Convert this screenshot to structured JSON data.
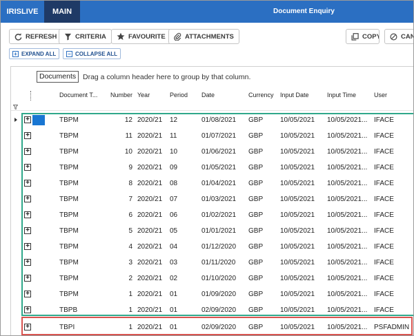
{
  "topbar": {
    "tabs": [
      {
        "label": "IRISLIVE"
      },
      {
        "label": "MAIN"
      }
    ],
    "title": "Document Enquiry"
  },
  "toolbar": {
    "refresh_label": "REFRESH",
    "criteria_label": "CRITERIA",
    "favourite_label": "FAVOURITE",
    "attachments_label": "ATTACHMENTS",
    "copy_label": "COPY",
    "cancel_label": "CANC"
  },
  "subtoolbar": {
    "expand_all_label": "EXPAND ALL",
    "collapse_all_label": "COLLAPSE ALL"
  },
  "grid": {
    "group_chip": "Documents",
    "group_hint": "Drag a column header here to group by that column.",
    "columns": [
      "Document T...",
      "Number",
      "Year",
      "Period",
      "Date",
      "Currency",
      "Input Date",
      "Input Time",
      "User"
    ],
    "rows": [
      {
        "doc_type": "TBPM",
        "number": "12",
        "year": "2020/21",
        "period": "12",
        "date": "01/08/2021",
        "currency": "GBP",
        "input_date": "10/05/2021",
        "input_time": "10/05/2021...",
        "user": "IFACE"
      },
      {
        "doc_type": "TBPM",
        "number": "11",
        "year": "2020/21",
        "period": "11",
        "date": "01/07/2021",
        "currency": "GBP",
        "input_date": "10/05/2021",
        "input_time": "10/05/2021...",
        "user": "IFACE"
      },
      {
        "doc_type": "TBPM",
        "number": "10",
        "year": "2020/21",
        "period": "10",
        "date": "01/06/2021",
        "currency": "GBP",
        "input_date": "10/05/2021",
        "input_time": "10/05/2021...",
        "user": "IFACE"
      },
      {
        "doc_type": "TBPM",
        "number": "9",
        "year": "2020/21",
        "period": "09",
        "date": "01/05/2021",
        "currency": "GBP",
        "input_date": "10/05/2021",
        "input_time": "10/05/2021...",
        "user": "IFACE"
      },
      {
        "doc_type": "TBPM",
        "number": "8",
        "year": "2020/21",
        "period": "08",
        "date": "01/04/2021",
        "currency": "GBP",
        "input_date": "10/05/2021",
        "input_time": "10/05/2021...",
        "user": "IFACE"
      },
      {
        "doc_type": "TBPM",
        "number": "7",
        "year": "2020/21",
        "period": "07",
        "date": "01/03/2021",
        "currency": "GBP",
        "input_date": "10/05/2021",
        "input_time": "10/05/2021...",
        "user": "IFACE"
      },
      {
        "doc_type": "TBPM",
        "number": "6",
        "year": "2020/21",
        "period": "06",
        "date": "01/02/2021",
        "currency": "GBP",
        "input_date": "10/05/2021",
        "input_time": "10/05/2021...",
        "user": "IFACE"
      },
      {
        "doc_type": "TBPM",
        "number": "5",
        "year": "2020/21",
        "period": "05",
        "date": "01/01/2021",
        "currency": "GBP",
        "input_date": "10/05/2021",
        "input_time": "10/05/2021...",
        "user": "IFACE"
      },
      {
        "doc_type": "TBPM",
        "number": "4",
        "year": "2020/21",
        "period": "04",
        "date": "01/12/2020",
        "currency": "GBP",
        "input_date": "10/05/2021",
        "input_time": "10/05/2021...",
        "user": "IFACE"
      },
      {
        "doc_type": "TBPM",
        "number": "3",
        "year": "2020/21",
        "period": "03",
        "date": "01/11/2020",
        "currency": "GBP",
        "input_date": "10/05/2021",
        "input_time": "10/05/2021...",
        "user": "IFACE"
      },
      {
        "doc_type": "TBPM",
        "number": "2",
        "year": "2020/21",
        "period": "02",
        "date": "01/10/2020",
        "currency": "GBP",
        "input_date": "10/05/2021",
        "input_time": "10/05/2021...",
        "user": "IFACE"
      },
      {
        "doc_type": "TBPM",
        "number": "1",
        "year": "2020/21",
        "period": "01",
        "date": "01/09/2020",
        "currency": "GBP",
        "input_date": "10/05/2021",
        "input_time": "10/05/2021...",
        "user": "IFACE"
      },
      {
        "doc_type": "TBPB",
        "number": "1",
        "year": "2020/21",
        "period": "01",
        "date": "02/09/2020",
        "currency": "GBP",
        "input_date": "10/05/2021",
        "input_time": "10/05/2021...",
        "user": "IFACE"
      },
      {
        "doc_type": "TBPI",
        "number": "1",
        "year": "2020/21",
        "period": "01",
        "date": "02/09/2020",
        "currency": "GBP",
        "input_date": "10/05/2021",
        "input_time": "10/05/2021...",
        "user": "PSFADMIN"
      }
    ]
  },
  "colors": {
    "accent": "#2b6fc2",
    "main_tab": "#1f3a66",
    "selection": "#1976d2",
    "highlight_green": "#2fa88a",
    "highlight_red": "#d9534f"
  }
}
